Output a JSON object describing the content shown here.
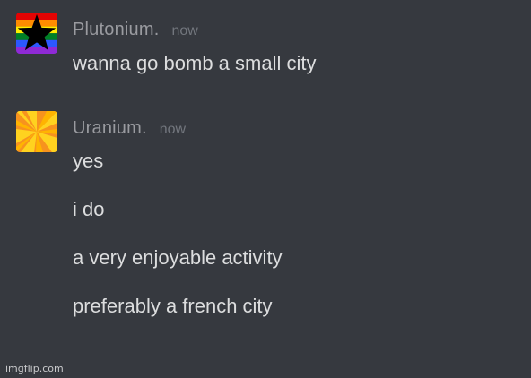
{
  "messages": [
    {
      "username": "Plutonium.",
      "timestamp": "now",
      "avatar": "pride-rainbow-star-icon",
      "lines": [
        "wanna go bomb a small city"
      ]
    },
    {
      "username": "Uranium.",
      "timestamp": "now",
      "avatar": "orange-yellow-pinwheel-icon",
      "lines": [
        "yes",
        "i do",
        "a very enjoyable activity",
        "preferably a french city"
      ]
    }
  ],
  "watermark": "imgflip.com",
  "colors": {
    "background": "#36393f",
    "username": "#9a9ba0",
    "timestamp": "#72767d",
    "message_text": "#dcddde"
  }
}
